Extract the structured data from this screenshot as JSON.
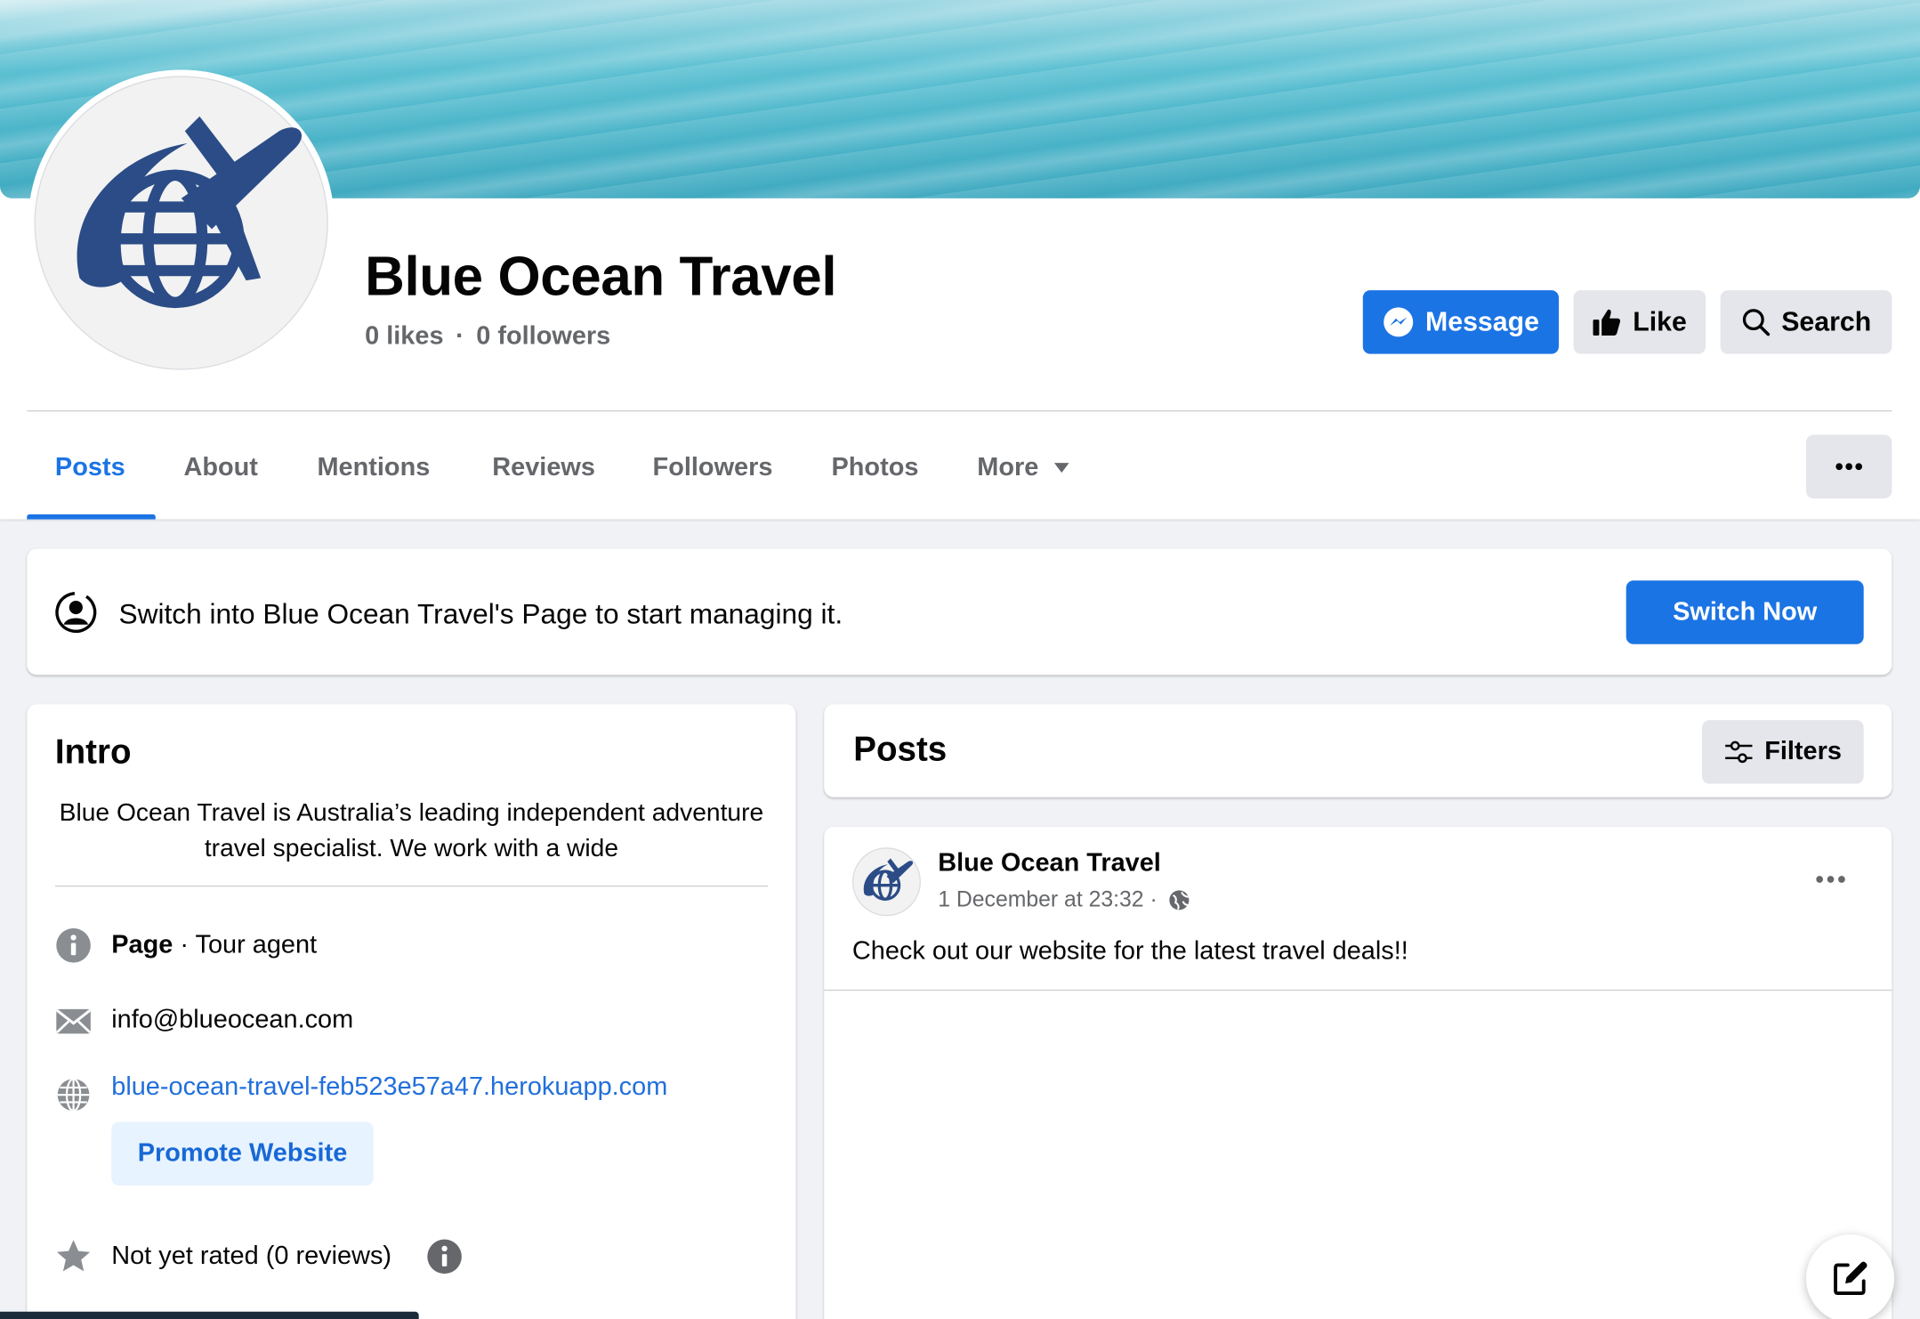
{
  "page": {
    "name": "Blue Ocean Travel",
    "likes": "0 likes",
    "followers": "0 followers",
    "dot": "·"
  },
  "actions": {
    "message": "Message",
    "like": "Like",
    "search": "Search"
  },
  "tabs": [
    {
      "label": "Posts",
      "active": true
    },
    {
      "label": "About"
    },
    {
      "label": "Mentions"
    },
    {
      "label": "Reviews"
    },
    {
      "label": "Followers"
    },
    {
      "label": "Photos"
    },
    {
      "label": "More"
    }
  ],
  "switch_banner": {
    "text": "Switch into Blue Ocean Travel's Page to start managing it.",
    "button": "Switch Now"
  },
  "intro": {
    "title": "Intro",
    "bio": "Blue Ocean Travel is Australia’s leading independent adventure travel specialist. We work with a wide",
    "category_label": "Page",
    "category_sep": " · ",
    "category": "Tour agent",
    "email": "info@blueocean.com",
    "website": "blue-ocean-travel-feb523e57a47.herokuapp.com",
    "promote_button": "Promote Website",
    "rating": "Not yet rated (0 reviews)"
  },
  "posts": {
    "title": "Posts",
    "filters": "Filters",
    "items": [
      {
        "author": "Blue Ocean Travel",
        "time": "1 December at 23:32",
        "meta_sep": " · ",
        "text": "Check out our website for the latest travel deals!!"
      }
    ]
  },
  "colors": {
    "accent": "#1b74e4",
    "link": "#216fdb",
    "logo": "#2b4c86"
  }
}
